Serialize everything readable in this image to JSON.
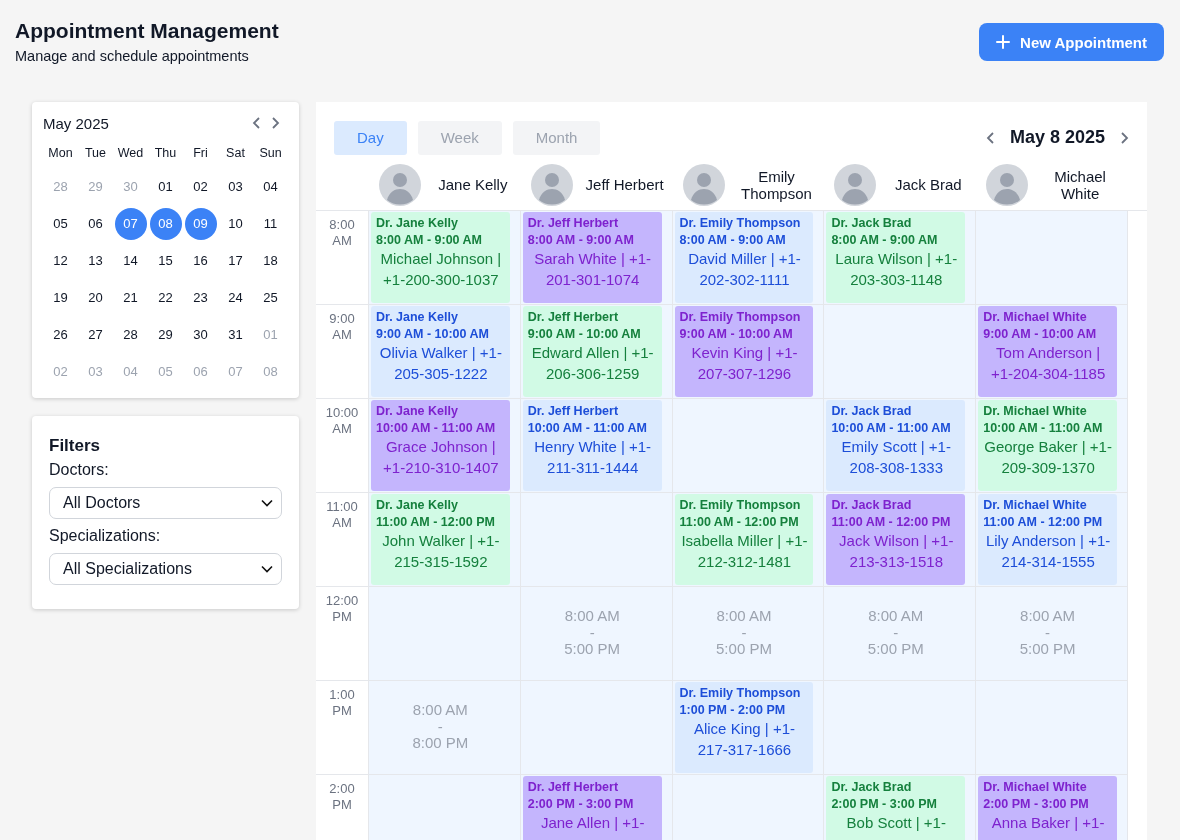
{
  "header": {
    "title": "Appointment Management",
    "subtitle": "Manage and schedule appointments",
    "new_button": "New Appointment"
  },
  "mini_calendar": {
    "month": "May 2025",
    "weekdays": [
      "Mon",
      "Tue",
      "Wed",
      "Thu",
      "Fri",
      "Sat",
      "Sun"
    ],
    "weeks": [
      [
        {
          "day": "28",
          "muted": true,
          "selected": false
        },
        {
          "day": "29",
          "muted": true,
          "selected": false
        },
        {
          "day": "30",
          "muted": true,
          "selected": false
        },
        {
          "day": "01",
          "muted": false,
          "selected": false
        },
        {
          "day": "02",
          "muted": false,
          "selected": false
        },
        {
          "day": "03",
          "muted": false,
          "selected": false
        },
        {
          "day": "04",
          "muted": false,
          "selected": false
        }
      ],
      [
        {
          "day": "05",
          "muted": false,
          "selected": false
        },
        {
          "day": "06",
          "muted": false,
          "selected": false
        },
        {
          "day": "07",
          "muted": false,
          "selected": true
        },
        {
          "day": "08",
          "muted": false,
          "selected": true
        },
        {
          "day": "09",
          "muted": false,
          "selected": true
        },
        {
          "day": "10",
          "muted": false,
          "selected": false
        },
        {
          "day": "11",
          "muted": false,
          "selected": false
        }
      ],
      [
        {
          "day": "12",
          "muted": false,
          "selected": false
        },
        {
          "day": "13",
          "muted": false,
          "selected": false
        },
        {
          "day": "14",
          "muted": false,
          "selected": false
        },
        {
          "day": "15",
          "muted": false,
          "selected": false
        },
        {
          "day": "16",
          "muted": false,
          "selected": false
        },
        {
          "day": "17",
          "muted": false,
          "selected": false
        },
        {
          "day": "18",
          "muted": false,
          "selected": false
        }
      ],
      [
        {
          "day": "19",
          "muted": false,
          "selected": false
        },
        {
          "day": "20",
          "muted": false,
          "selected": false
        },
        {
          "day": "21",
          "muted": false,
          "selected": false
        },
        {
          "day": "22",
          "muted": false,
          "selected": false
        },
        {
          "day": "23",
          "muted": false,
          "selected": false
        },
        {
          "day": "24",
          "muted": false,
          "selected": false
        },
        {
          "day": "25",
          "muted": false,
          "selected": false
        }
      ],
      [
        {
          "day": "26",
          "muted": false,
          "selected": false
        },
        {
          "day": "27",
          "muted": false,
          "selected": false
        },
        {
          "day": "28",
          "muted": false,
          "selected": false
        },
        {
          "day": "29",
          "muted": false,
          "selected": false
        },
        {
          "day": "30",
          "muted": false,
          "selected": false
        },
        {
          "day": "31",
          "muted": false,
          "selected": false
        },
        {
          "day": "01",
          "muted": true,
          "selected": false
        }
      ],
      [
        {
          "day": "02",
          "muted": true,
          "selected": false
        },
        {
          "day": "03",
          "muted": true,
          "selected": false
        },
        {
          "day": "04",
          "muted": true,
          "selected": false
        },
        {
          "day": "05",
          "muted": true,
          "selected": false
        },
        {
          "day": "06",
          "muted": true,
          "selected": false
        },
        {
          "day": "07",
          "muted": true,
          "selected": false
        },
        {
          "day": "08",
          "muted": true,
          "selected": false
        }
      ]
    ]
  },
  "filters": {
    "title": "Filters",
    "doctors_label": "Doctors:",
    "doctors_value": "All Doctors",
    "specializations_label": "Specializations:",
    "specializations_value": "All Specializations"
  },
  "view_tabs": [
    {
      "label": "Day",
      "selected": true
    },
    {
      "label": "Week",
      "selected": false
    },
    {
      "label": "Month",
      "selected": false
    }
  ],
  "current_date": "May 8 2025",
  "time_slots": [
    "8:00 AM",
    "9:00 AM",
    "10:00 AM",
    "11:00 AM",
    "12:00 PM",
    "1:00 PM",
    "2:00 PM"
  ],
  "doctors": [
    {
      "name": "Jane Kelly",
      "slots": [
        {
          "kind": "appointment",
          "color": "#d1fae5",
          "doctor": "Dr. Jane Kelly",
          "time": "8:00 AM - 9:00 AM",
          "patient": "Michael Johnson | +1-200-300-1037"
        },
        {
          "kind": "appointment",
          "color": "#dbeafe",
          "doctor": "Dr. Jane Kelly",
          "time": "9:00 AM - 10:00 AM",
          "patient": "Olivia Walker | +1-205-305-1222"
        },
        {
          "kind": "appointment",
          "color": "#c4b5fd",
          "doctor": "Dr. Jane Kelly",
          "time": "10:00 AM - 11:00 AM",
          "patient": "Grace Johnson | +1-210-310-1407"
        },
        {
          "kind": "appointment",
          "color": "#d1fae5",
          "doctor": "Dr. Jane Kelly",
          "time": "11:00 AM - 12:00 PM",
          "patient": "John Walker | +1-215-315-1592"
        },
        {
          "kind": "empty"
        },
        {
          "kind": "hours",
          "lines": [
            "8:00 AM",
            "-",
            "8:00 PM"
          ]
        },
        {
          "kind": "empty"
        }
      ]
    },
    {
      "name": "Jeff Herbert",
      "slots": [
        {
          "kind": "appointment",
          "color": "#c4b5fd",
          "doctor": "Dr. Jeff Herbert",
          "time": "8:00 AM - 9:00 AM",
          "patient": "Sarah White | +1-201-301-1074"
        },
        {
          "kind": "appointment",
          "color": "#d1fae5",
          "doctor": "Dr. Jeff Herbert",
          "time": "9:00 AM - 10:00 AM",
          "patient": "Edward Allen | +1-206-306-1259"
        },
        {
          "kind": "appointment",
          "color": "#dbeafe",
          "doctor": "Dr. Jeff Herbert",
          "time": "10:00 AM - 11:00 AM",
          "patient": "Henry White | +1-211-311-1444"
        },
        {
          "kind": "empty"
        },
        {
          "kind": "hours",
          "lines": [
            "8:00 AM",
            "-",
            "5:00 PM"
          ]
        },
        {
          "kind": "empty"
        },
        {
          "kind": "appointment",
          "color": "#c4b5fd",
          "doctor": "Dr. Jeff Herbert",
          "time": "2:00 PM - 3:00 PM",
          "patient": "Jane Allen | +1-"
        }
      ]
    },
    {
      "name": "Emily Thompson",
      "slots": [
        {
          "kind": "appointment",
          "color": "#dbeafe",
          "doctor": "Dr. Emily Thompson",
          "time": "8:00 AM - 9:00 AM",
          "patient": "David Miller | +1-202-302-1111"
        },
        {
          "kind": "appointment",
          "color": "#c4b5fd",
          "doctor": "Dr. Emily Thompson",
          "time": "9:00 AM - 10:00 AM",
          "patient": "Kevin King | +1-207-307-1296"
        },
        {
          "kind": "empty"
        },
        {
          "kind": "appointment",
          "color": "#d1fae5",
          "doctor": "Dr. Emily Thompson",
          "time": "11:00 AM - 12:00 PM",
          "patient": "Isabella Miller | +1-212-312-1481"
        },
        {
          "kind": "hours",
          "lines": [
            "8:00 AM",
            "-",
            "5:00 PM"
          ]
        },
        {
          "kind": "appointment",
          "color": "#dbeafe",
          "doctor": "Dr. Emily Thompson",
          "time": "1:00 PM - 2:00 PM",
          "patient": "Alice King | +1-217-317-1666"
        },
        {
          "kind": "empty"
        }
      ]
    },
    {
      "name": "Jack Brad",
      "slots": [
        {
          "kind": "appointment",
          "color": "#d1fae5",
          "doctor": "Dr. Jack Brad",
          "time": "8:00 AM - 9:00 AM",
          "patient": "Laura Wilson | +1-203-303-1148"
        },
        {
          "kind": "empty"
        },
        {
          "kind": "appointment",
          "color": "#dbeafe",
          "doctor": "Dr. Jack Brad",
          "time": "10:00 AM - 11:00 AM",
          "patient": "Emily Scott | +1-208-308-1333"
        },
        {
          "kind": "appointment",
          "color": "#c4b5fd",
          "doctor": "Dr. Jack Brad",
          "time": "11:00 AM - 12:00 PM",
          "patient": "Jack Wilson | +1-213-313-1518"
        },
        {
          "kind": "hours",
          "lines": [
            "8:00 AM",
            "-",
            "5:00 PM"
          ]
        },
        {
          "kind": "empty"
        },
        {
          "kind": "appointment",
          "color": "#d1fae5",
          "doctor": "Dr. Jack Brad",
          "time": "2:00 PM - 3:00 PM",
          "patient": "Bob Scott | +1-"
        }
      ]
    },
    {
      "name": "Michael White",
      "slots": [
        {
          "kind": "empty"
        },
        {
          "kind": "appointment",
          "color": "#c4b5fd",
          "doctor": "Dr. Michael White",
          "time": "9:00 AM - 10:00 AM",
          "patient": "Tom Anderson | +1-204-304-1185"
        },
        {
          "kind": "appointment",
          "color": "#d1fae5",
          "doctor": "Dr. Michael White",
          "time": "10:00 AM - 11:00 AM",
          "patient": "George Baker | +1-209-309-1370"
        },
        {
          "kind": "appointment",
          "color": "#dbeafe",
          "doctor": "Dr. Michael White",
          "time": "11:00 AM - 12:00 PM",
          "patient": "Lily Anderson | +1-214-314-1555"
        },
        {
          "kind": "hours",
          "lines": [
            "8:00 AM",
            "-",
            "5:00 PM"
          ]
        },
        {
          "kind": "empty"
        },
        {
          "kind": "appointment",
          "color": "#c4b5fd",
          "doctor": "Dr. Michael White",
          "time": "2:00 PM - 3:00 PM",
          "patient": "Anna Baker | +1-"
        }
      ]
    }
  ]
}
